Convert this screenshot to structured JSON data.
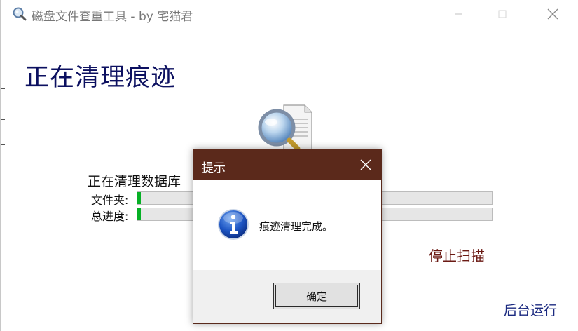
{
  "window": {
    "title": "磁盘文件查重工具 - by 宅猫君",
    "icon": "magnifier-app-icon",
    "controls": {
      "minimize": "minimize-icon",
      "maximize": "maximize-icon",
      "close": "close-icon"
    }
  },
  "main": {
    "heading": "正在清理痕迹",
    "status_text": "正在清理数据库",
    "folder_label": "文件夹:",
    "total_label": "总进度:",
    "folder_progress": 0.01,
    "total_progress": 0.01,
    "stop_link": "停止扫描",
    "background_link": "后台运行",
    "accent_color": "#0c1060",
    "progress_color": "#06b025"
  },
  "dialog": {
    "title": "提示",
    "message": "痕迹清理完成。",
    "ok_label": "确定",
    "icon": "info-icon",
    "titlebar_color": "#5b291b"
  }
}
